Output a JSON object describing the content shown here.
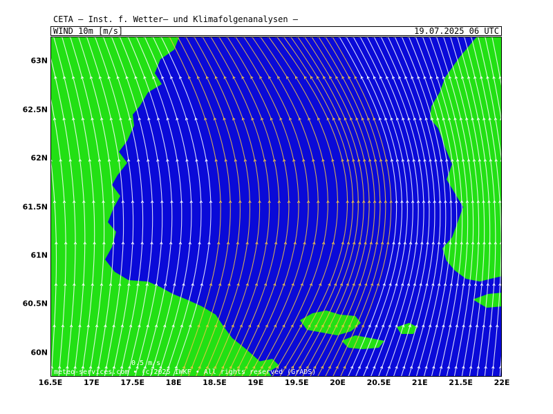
{
  "header": {
    "title": "CETA — Inst. f. Wetter— und Klimafolgenanalysen —",
    "field": "WIND_10m  [m/s]",
    "timestamp": "19.07.2025  06 UTC"
  },
  "map": {
    "lat_labels": [
      "63N",
      "62.5N",
      "62N",
      "61.5N",
      "61N",
      "60.5N",
      "60N"
    ],
    "lon_labels": [
      "16.5E",
      "17E",
      "17.5E",
      "18E",
      "18.5E",
      "19E",
      "19.5E",
      "20E",
      "20.5E",
      "21E",
      "21.5E",
      "22E"
    ],
    "lon_range": [
      16.5,
      22.0
    ],
    "lat_range": [
      59.75,
      63.25
    ],
    "reference_vector": "0.5 m/s",
    "credit": "meteo-services.com • (c)2025 IWKF • All rights reserved (GrADS)"
  },
  "colors": {
    "sea": "#0a0ad8",
    "land": "#22e014",
    "streamline": "#ffffff",
    "strong_wind": "#f2c447"
  }
}
